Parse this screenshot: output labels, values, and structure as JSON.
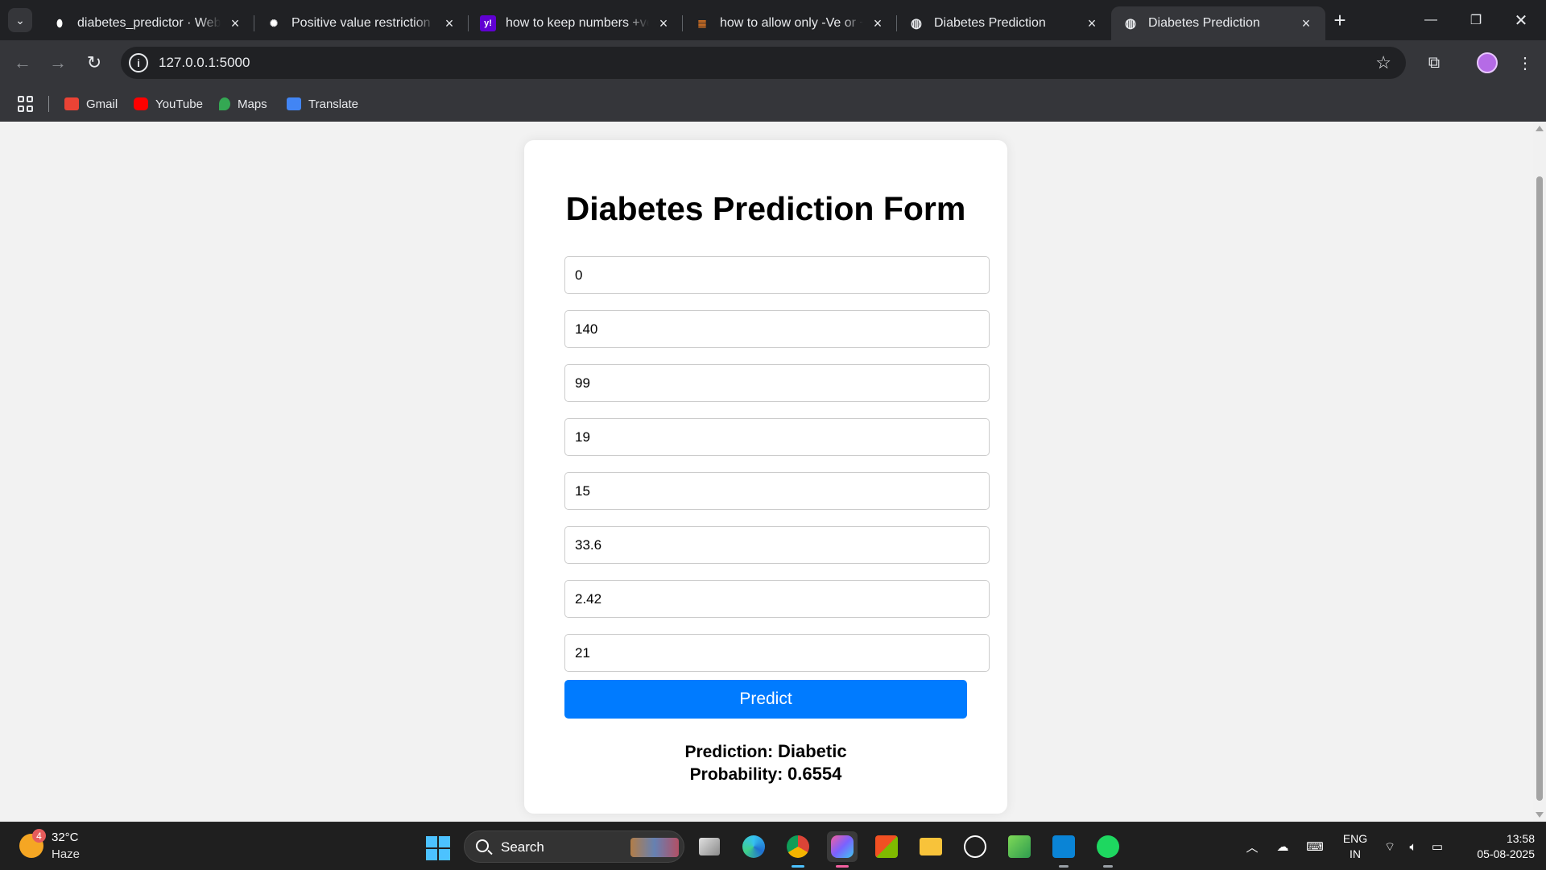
{
  "browser": {
    "tabs": [
      {
        "title": "diabetes_predictor · Web Service",
        "icon": "render-icon",
        "active": false
      },
      {
        "title": "Positive value restriction",
        "icon": "chatgpt-icon",
        "active": false
      },
      {
        "title": "how to keep numbers +ve only",
        "icon": "yahoo-icon",
        "active": false
      },
      {
        "title": "how to allow only -Ve or +Ve",
        "icon": "stackoverflow-icon",
        "active": false
      },
      {
        "title": "Diabetes Prediction",
        "icon": "globe-icon",
        "active": false
      },
      {
        "title": "Diabetes Prediction",
        "icon": "globe-icon",
        "active": true
      }
    ],
    "url": "127.0.0.1:5000",
    "bookmarks": [
      {
        "label": "Gmail",
        "icon": "gmail-icon",
        "color": "#ea4335"
      },
      {
        "label": "YouTube",
        "icon": "youtube-icon",
        "color": "#ff0000"
      },
      {
        "label": "Maps",
        "icon": "maps-icon",
        "color": "#34a853"
      },
      {
        "label": "Translate",
        "icon": "translate-icon",
        "color": "#4285f4"
      }
    ]
  },
  "page": {
    "title": "Diabetes Prediction Form",
    "fields": [
      "0",
      "140",
      "99",
      "19",
      "15",
      "33.6",
      "2.42",
      "21"
    ],
    "button_label": "Predict",
    "prediction_label": "Prediction:",
    "prediction_value": "Diabetic",
    "probability_label": "Probability:",
    "probability_value": "0.6554",
    "accent_color": "#007bff"
  },
  "taskbar": {
    "weather_badge": "4",
    "temperature": "32°C",
    "weather": "Haze",
    "search_label": "Search",
    "lang_line1": "ENG",
    "lang_line2": "IN",
    "time": "13:58",
    "date": "05-08-2025"
  }
}
